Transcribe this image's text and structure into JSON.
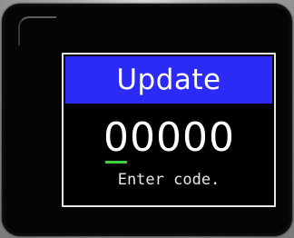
{
  "dialog": {
    "title": "Update",
    "code_digits": [
      "0",
      "0",
      "0",
      "0",
      "0"
    ],
    "active_digit_index": 0,
    "hint": "Enter code."
  },
  "colors": {
    "title_bar": "#2b2bf5",
    "cursor": "#3fd23f",
    "screen_bg": "#000000",
    "text": "#ffffff"
  }
}
